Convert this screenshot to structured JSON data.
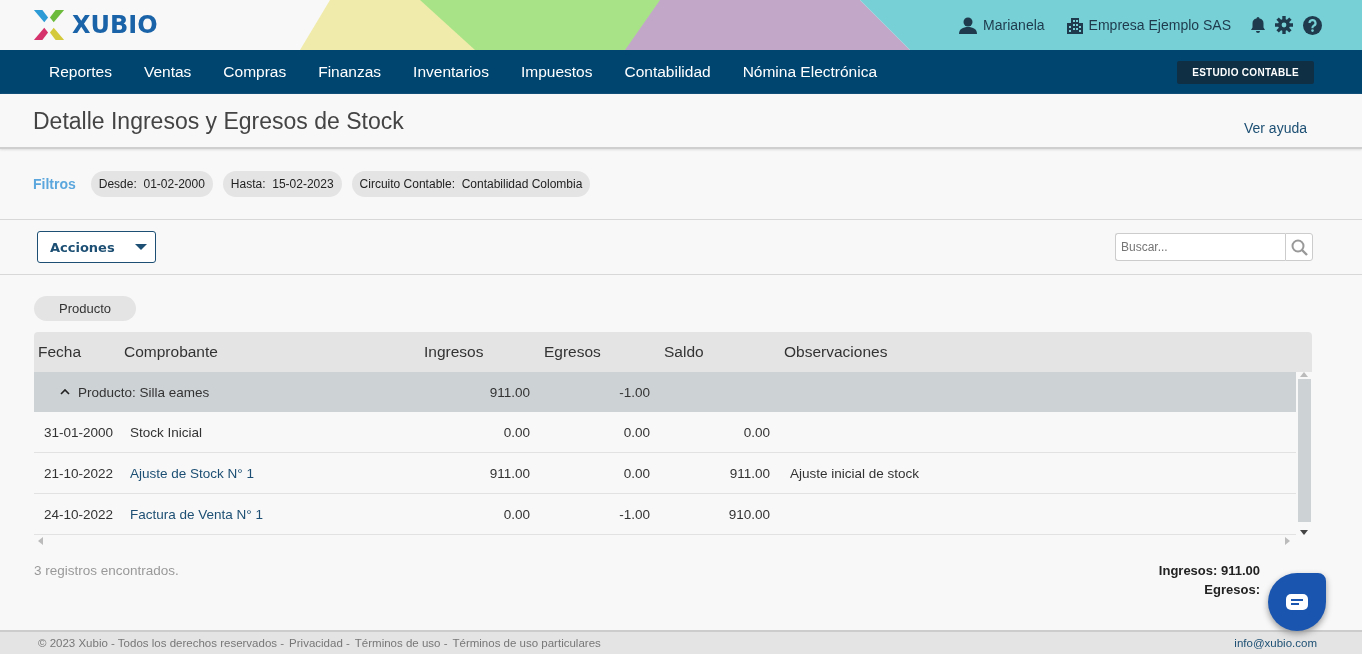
{
  "header": {
    "logo": "XUBIO",
    "user": "Marianela",
    "company": "Empresa Ejemplo SAS"
  },
  "nav": {
    "items": [
      {
        "label": "Reportes"
      },
      {
        "label": "Ventas"
      },
      {
        "label": "Compras"
      },
      {
        "label": "Finanzas"
      },
      {
        "label": "Inventarios"
      },
      {
        "label": "Impuestos"
      },
      {
        "label": "Contabilidad"
      },
      {
        "label": "Nómina Electrónica"
      }
    ],
    "badge": "ESTUDIO CONTABLE"
  },
  "page": {
    "title": "Detalle Ingresos y Egresos de Stock",
    "help_link": "Ver ayuda"
  },
  "filters": {
    "label": "Filtros",
    "chips": [
      {
        "name": "Desde:",
        "value": "01-02-2000"
      },
      {
        "name": "Hasta:",
        "value": "15-02-2023"
      },
      {
        "name": "Circuito Contable:",
        "value": "Contabilidad Colombia"
      }
    ]
  },
  "toolbar": {
    "actions": "Acciones",
    "search": {
      "placeholder": "Buscar..."
    }
  },
  "grouping": [
    "Producto"
  ],
  "table": {
    "columns": [
      "Fecha",
      "Comprobante",
      "Ingresos",
      "Egresos",
      "Saldo",
      "Observaciones"
    ],
    "groups": [
      {
        "label": "Producto: Silla eames",
        "expanded": true,
        "ingresos": "911.00",
        "egresos": "-1.00",
        "rows": [
          {
            "fecha": "31-01-2000",
            "comprobante": "Stock Inicial",
            "linked": false,
            "ingresos": "0.00",
            "egresos": "0.00",
            "saldo": "0.00"
          },
          {
            "fecha": "21-10-2022",
            "comprobante": "Ajuste de Stock N° 1",
            "linked": true,
            "ingresos": "911.00",
            "egresos": "0.00",
            "saldo": "911.00",
            "observaciones": "Ajuste inicial de stock"
          },
          {
            "fecha": "24-10-2022",
            "comprobante": "Factura de Venta N° 1",
            "linked": true,
            "ingresos": "0.00",
            "egresos": "-1.00",
            "saldo": "910.00"
          }
        ]
      }
    ]
  },
  "summary": {
    "count": "3 registros encontrados.",
    "totals": [
      "Ingresos: 911.00",
      "Egresos:"
    ]
  },
  "footer": {
    "items": [
      "© 2023 Xubio - Todos los derechos reservados -",
      "Privacidad -",
      "Términos de uso -",
      "Términos de uso particulares"
    ],
    "email": "info@xubio.com"
  }
}
